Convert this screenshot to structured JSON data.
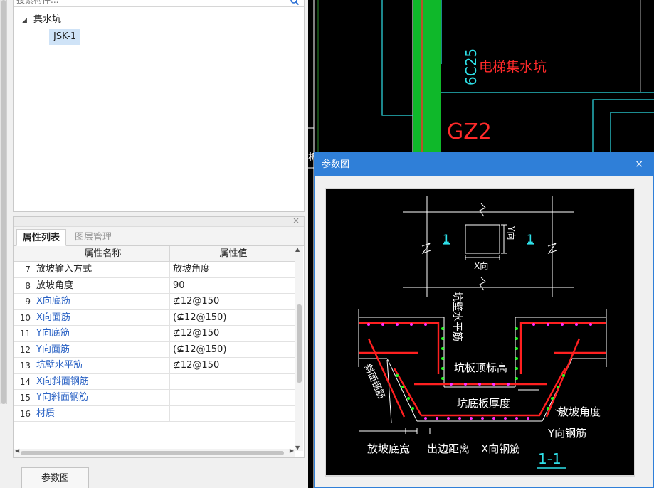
{
  "tree": {
    "search_placeholder": "搜索构件...",
    "group_label": "集水坑",
    "item_label": "JSK-1"
  },
  "properties": {
    "tabs": [
      "属性列表",
      "图层管理"
    ],
    "col_name": "属性名称",
    "col_value": "属性值",
    "rows": [
      {
        "num": "7",
        "name": "放坡输入方式",
        "value": "放坡角度"
      },
      {
        "num": "8",
        "name": "放坡角度",
        "value": "90"
      },
      {
        "num": "9",
        "name": "X向底筋",
        "value": "⊈12@150"
      },
      {
        "num": "10",
        "name": "X向面筋",
        "value": "(⊈12@150)"
      },
      {
        "num": "11",
        "name": "Y向底筋",
        "value": "⊈12@150"
      },
      {
        "num": "12",
        "name": "Y向面筋",
        "value": "(⊈12@150)"
      },
      {
        "num": "13",
        "name": "坑壁水平筋",
        "value": "⊈12@150"
      },
      {
        "num": "14",
        "name": "X向斜面钢筋",
        "value": ""
      },
      {
        "num": "15",
        "name": "Y向斜面钢筋",
        "value": ""
      },
      {
        "num": "16",
        "name": "材质",
        "value": ""
      }
    ],
    "bottom_button": "参数图"
  },
  "cad": {
    "label_rebar": "6C25",
    "label_pit": "电梯集水坑",
    "label_gz": "GZ2"
  },
  "dialog": {
    "title": "参数图",
    "close_glyph": "×",
    "diagram": {
      "section_mark": "1",
      "x_dir": "X向",
      "y_dir": "Y向",
      "wall_rebar": "坑壁水平筋",
      "slope_rebar": "斜面钢筋",
      "top_elev": "坑板顶标高",
      "bottom_thick": "坑底板厚度",
      "slope_angle": "放坡角度",
      "y_rebar": "Y向钢筋",
      "x_rebar": "X向钢筋",
      "slope_width": "放坡底宽",
      "edge_dist": "出边距离",
      "section_label": "1-1"
    }
  }
}
